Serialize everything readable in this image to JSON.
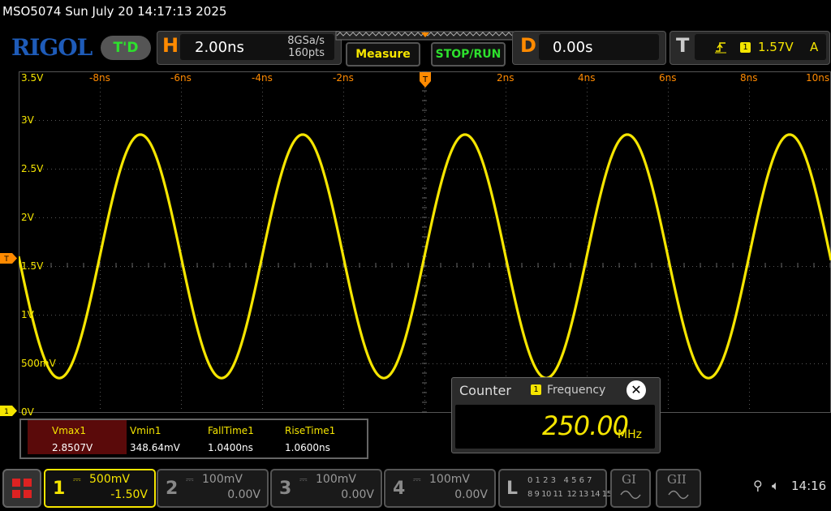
{
  "title": "MSO5074  Sun July 20 14:17:13 2025",
  "brand": "RIGOL",
  "td_badge": "T'D",
  "horizontal": {
    "letter": "H",
    "timebase": "2.00ns",
    "sample_rate": "8GSa/s",
    "points": "160pts"
  },
  "buttons": {
    "measure": "Measure",
    "stop_run": "STOP/RUN"
  },
  "delay": {
    "letter": "D",
    "value": "0.00s"
  },
  "trigger": {
    "letter": "T",
    "edge_icon": "rising-edge-icon",
    "channel": "1",
    "level": "1.57V",
    "mode": "A"
  },
  "time_labels": [
    "-8ns",
    "-6ns",
    "-4ns",
    "-2ns",
    "2ns",
    "4ns",
    "6ns",
    "8ns",
    "10ns"
  ],
  "volt_labels": [
    "3.5V",
    "3V",
    "2.5V",
    "2V",
    "1.5V",
    "1V",
    "500mV",
    "0V"
  ],
  "markers": {
    "trigger_level": "T",
    "ch1_ground": "1"
  },
  "measurements": {
    "headers": [
      "Vmax1",
      "Vmin1",
      "FallTime1",
      "RiseTime1"
    ],
    "values": [
      "2.8507V",
      "348.64mV",
      "1.0400ns",
      "1.0600ns"
    ]
  },
  "counter": {
    "title": "Counter",
    "channel": "1",
    "type": "Frequency",
    "value": "250.00",
    "unit": "MHz"
  },
  "channels": [
    {
      "num": "1",
      "scale": "500mV",
      "offset": "-1.50V"
    },
    {
      "num": "2",
      "scale": "100mV",
      "offset": "0.00V"
    },
    {
      "num": "3",
      "scale": "100mV",
      "offset": "0.00V"
    },
    {
      "num": "4",
      "scale": "100mV",
      "offset": "0.00V"
    }
  ],
  "logic": {
    "letter": "L",
    "row1": "0 1 2 3   4 5 6 7",
    "row2": "8 9 10 11  12 13 14 15"
  },
  "gen1": "GI",
  "gen2": "GII",
  "status": {
    "time": "14:16"
  },
  "signal": {
    "frequency_mhz": 250,
    "vmax": 2.8507,
    "vmin": 0.34864,
    "phase_at_zero": "rising-zero-crossing"
  },
  "colors": {
    "ch1": "#f5e500",
    "accent": "#ff8a00",
    "brand": "#1e5bb8",
    "run": "#2de02d"
  }
}
